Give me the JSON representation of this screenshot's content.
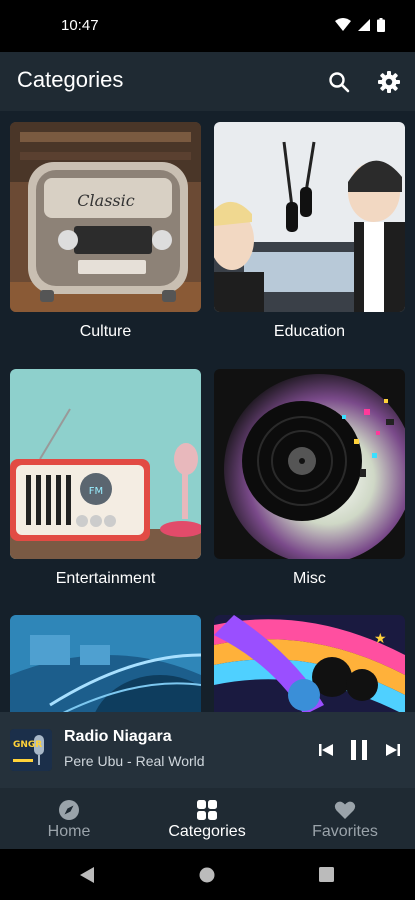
{
  "status": {
    "time": "10:47"
  },
  "app_bar": {
    "title": "Categories",
    "actions": [
      "search-icon",
      "gear-icon"
    ]
  },
  "categories": [
    {
      "label": "Culture"
    },
    {
      "label": "Education"
    },
    {
      "label": "Entertainment"
    },
    {
      "label": "Misc"
    },
    {
      "label": ""
    },
    {
      "label": ""
    }
  ],
  "player": {
    "title": "Radio Niagara",
    "subtitle": "Pere Ubu - Real World",
    "art_text": "GNGR"
  },
  "nav": {
    "home": "Home",
    "categories": "Categories",
    "favorites": "Favorites",
    "active": "categories"
  },
  "colors": {
    "app_bar": "#1f2a33",
    "background": "#15202a",
    "player": "#25313b",
    "active_nav": "#ffffff",
    "inactive_nav": "#9aa3aa"
  }
}
